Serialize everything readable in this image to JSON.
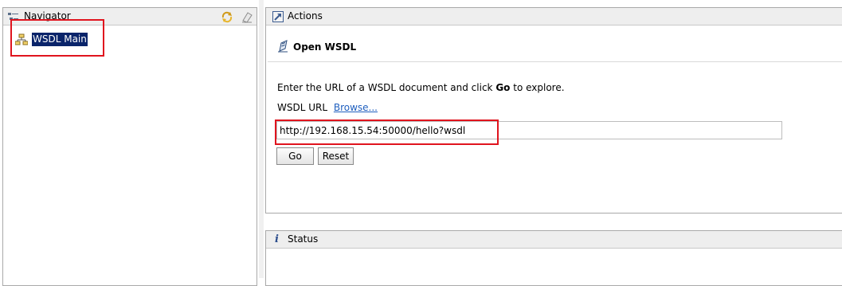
{
  "navigator": {
    "title": "Navigator",
    "tree_item": "WSDL Main",
    "icons": {
      "title": "navigator-icon",
      "refresh": "refresh-icon",
      "clear": "clear-icon",
      "tree_item": "wsdl-tree-icon"
    }
  },
  "actions": {
    "title": "Actions",
    "section_title": "Open WSDL",
    "instructions_before": "Enter the URL of a WSDL document and click",
    "instructions_bold": "Go",
    "instructions_after": "to explore.",
    "url_label": "WSDL URL",
    "browse_link": "Browse...",
    "url_value": "http://192.168.15.54:50000/hello?wsdl",
    "go_button": "Go",
    "reset_button": "Reset",
    "icons": {
      "title": "actions-icon",
      "section": "open-wsdl-icon"
    }
  },
  "status": {
    "title": "Status",
    "icons": {
      "title": "info-icon"
    }
  },
  "colors": {
    "highlight": "#e0141e",
    "selection_bg": "#0a246a",
    "link": "#1f5fbf"
  }
}
